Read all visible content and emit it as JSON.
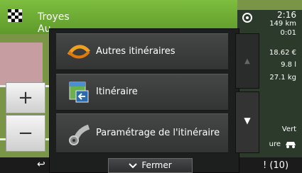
{
  "destination": {
    "line1": "Troyes",
    "line2": "Au"
  },
  "info_panel": {
    "time": "2:16",
    "distance": "149 km",
    "remaining": "0:01",
    "cost": "18.62 €",
    "fuel": "9.8 l",
    "co2": "27.1 kg",
    "signal_label": "Vert",
    "mode_label": "ure",
    "bottom_label": "! (10)"
  },
  "map_controls": {
    "zoom_in": "+",
    "zoom_out": "−"
  },
  "menu": {
    "items": [
      {
        "label": "Autres itinéraires",
        "icon": "alternative-routes-icon"
      },
      {
        "label": "Itinéraire",
        "icon": "itinerary-icon"
      },
      {
        "label": "Paramétrage de l'itinéraire",
        "icon": "route-settings-icon"
      }
    ],
    "scroll_up": "▲",
    "scroll_down": "▼"
  },
  "close_button": {
    "label": "Fermer",
    "icon": "chevron-down-icon"
  },
  "back_button": {
    "label": "↩",
    "icon": "back-icon"
  }
}
